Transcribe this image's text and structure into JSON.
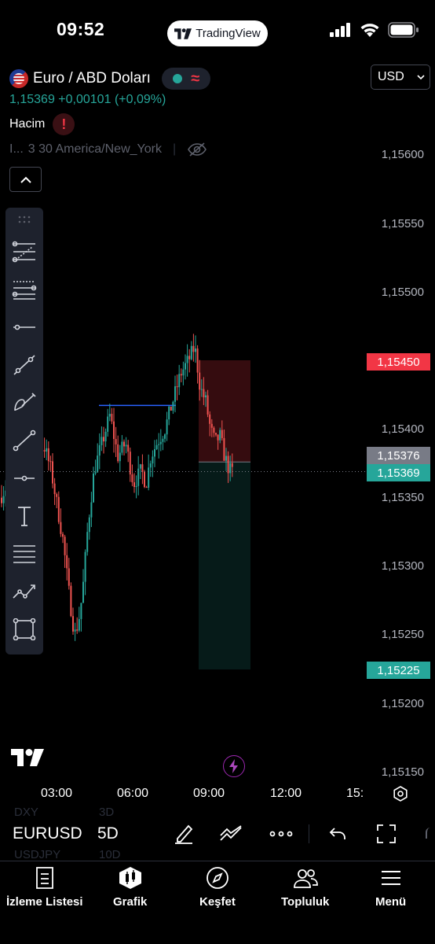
{
  "status_bar": {
    "time": "09:52",
    "pill_label": "TradingView"
  },
  "header": {
    "symbol_name": "Euro / ABD Doları",
    "currency": "USD",
    "price": "1,15369",
    "change": "+0,00101",
    "change_pct": "(+0,09%)",
    "volume_label": "Hacim",
    "session_prefix": "I...",
    "session_text": "3 30 America/New_York"
  },
  "colors": {
    "up": "#26a69a",
    "down": "#ef5350",
    "accent_red": "#f23645",
    "line_blue": "#2962ff"
  },
  "price_axis": [
    "1,15600",
    "1,15550",
    "1,15500",
    "1,15400",
    "1,15350",
    "1,15300",
    "1,15250",
    "1,15200",
    "1,15150"
  ],
  "price_tags": {
    "stop": "1,15450",
    "entry": "1,15376",
    "last": "1,15369",
    "target": "1,15225"
  },
  "time_axis": [
    "03:00",
    "06:00",
    "09:00",
    "12:00",
    "15:"
  ],
  "chart_data": {
    "type": "candlestick",
    "ylim": [
      1.1515,
      1.1561
    ],
    "x_ticks": [
      "03:00",
      "06:00",
      "09:00",
      "12:00",
      "15:"
    ],
    "last_price": 1.15369,
    "position": {
      "entry": 1.15376,
      "stop": 1.1545,
      "target": 1.15225
    },
    "horizontal_line": 1.1542
  },
  "toolbar": {
    "tools": [
      "fib-retracement-icon",
      "fib-channel-icon",
      "horizontal-ray-icon",
      "trend-line-icon",
      "brush-icon",
      "line-icon",
      "cross-line-icon",
      "text-icon",
      "parallel-channel-icon",
      "pattern-icon",
      "rectangle-icon"
    ]
  },
  "symbol_bar": {
    "ghost_prev_symbol": "DXY",
    "ghost_prev_tf": "3D",
    "symbol": "EURUSD",
    "timeframe": "5D",
    "ghost_next_symbol": "USDJPY",
    "ghost_next_tf": "10D"
  },
  "tabs": [
    {
      "label": "İzleme Listesi",
      "icon": "watchlist-icon"
    },
    {
      "label": "Grafik",
      "icon": "chart-icon"
    },
    {
      "label": "Keşfet",
      "icon": "compass-icon"
    },
    {
      "label": "Topluluk",
      "icon": "community-icon"
    },
    {
      "label": "Menü",
      "icon": "menu-icon"
    }
  ]
}
